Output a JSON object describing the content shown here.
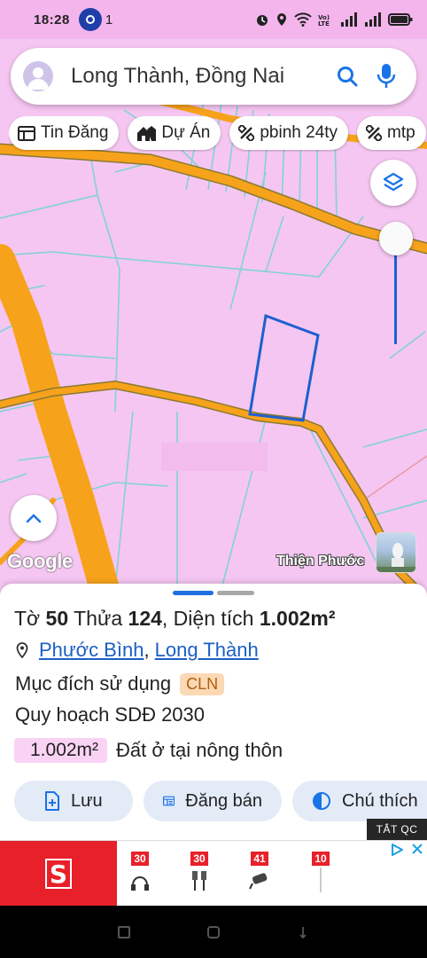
{
  "status_bar": {
    "time": "18:28",
    "notification_count": "1"
  },
  "search": {
    "query": "Long Thành, Đồng Nai"
  },
  "chips": [
    {
      "label": "Tin Đăng",
      "icon": "calendar-icon"
    },
    {
      "label": "Dự Án",
      "icon": "houses-icon"
    },
    {
      "label": "pbinh 24ty",
      "icon": "percent-icon"
    },
    {
      "label": "mtp",
      "icon": "percent-icon"
    }
  ],
  "map": {
    "attribution": "Google",
    "place_label": "Thiện Phước",
    "colors": {
      "land": "#f5c6f1",
      "road": "#f7a21b",
      "boundary": "#7fd3d6",
      "parcel": "#1e5fd0"
    }
  },
  "parcel": {
    "sheet_prefix": "Tờ",
    "sheet_number": "50",
    "parcel_prefix": "Thửa",
    "parcel_number": "124",
    "area_prefix": ", Diện tích",
    "area_value": "1.002m²",
    "ward": "Phước Bình",
    "district": "Long Thành",
    "purpose_label": "Mục đích sử dụng",
    "purpose_code": "CLN",
    "planning_label": "Quy hoạch SDĐ 2030",
    "planning_area": "1.002m²",
    "planning_type": "Đất ở tại nông thôn"
  },
  "actions": {
    "save": "Lưu",
    "post": "Đăng bán",
    "legend": "Chú thích"
  },
  "ad": {
    "close_label": "TẮT QC",
    "logo_letter": "S",
    "item_numbers": [
      "30",
      "30",
      "41",
      "10"
    ]
  }
}
